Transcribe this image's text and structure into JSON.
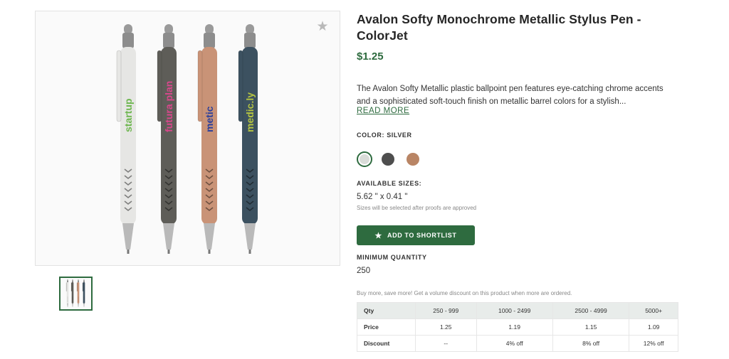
{
  "product": {
    "title_line1": "Avalon Softy Monochrome Metallic Stylus Pen -",
    "title_line2": "ColorJet",
    "price": "$1.25",
    "description_line1": "The Avalon Softy Metallic plastic ballpoint pen features eye-catching chrome accents",
    "description_line2": "and a sophisticated soft-touch finish on metallic barrel colors for a stylish...",
    "read_more": "READ MORE",
    "color_label": "COLOR: SILVER",
    "colors": [
      {
        "name": "silver",
        "hex": "#d9dcd8",
        "selected": true
      },
      {
        "name": "gunmetal",
        "hex": "#4e4e4e",
        "selected": false
      },
      {
        "name": "copper",
        "hex": "#b98565",
        "selected": false
      }
    ],
    "sizes_label": "AVAILABLE SIZES:",
    "size_value": "5.62 \" x 0.41 \"",
    "size_note": "Sizes will be selected after proofs are approved",
    "shortlist_label": "ADD TO SHORTLIST",
    "min_qty_label": "MINIMUM QUANTITY",
    "min_qty_value": "250",
    "volume_note": "Buy more, save more! Get a volume discount on this product when more are ordered."
  },
  "gallery": {
    "pen_logos": [
      "startup",
      "futura plan",
      "metic",
      "medic.ly"
    ],
    "pen_colors": [
      "#e6e6e4",
      "#5e5d58",
      "#c99377",
      "#3c5160"
    ],
    "logo_colors": [
      "#6db64f",
      "#d9478c",
      "#2a3f9c",
      "#b5c441"
    ]
  },
  "pricing": {
    "headers": [
      "Qty",
      "250 - 999",
      "1000 - 2499",
      "2500 - 4999",
      "5000+"
    ],
    "rows": [
      [
        "Price",
        "1.25",
        "1.19",
        "1.15",
        "1.09"
      ],
      [
        "Discount",
        "--",
        "4% off",
        "8% off",
        "12% off"
      ]
    ]
  },
  "colors": {
    "accent": "#2e6b3f"
  }
}
